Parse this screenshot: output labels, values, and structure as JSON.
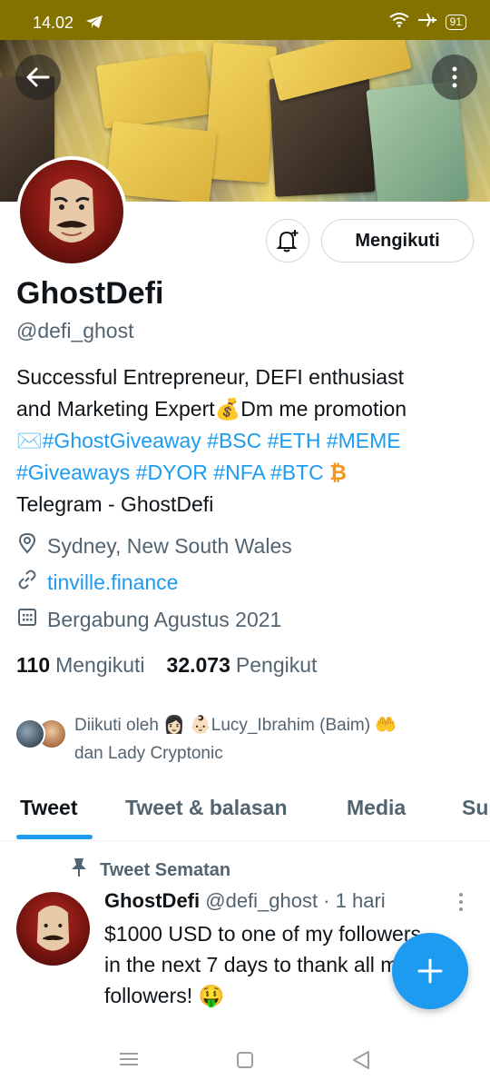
{
  "status_bar": {
    "time": "14.02",
    "battery": "91"
  },
  "profile": {
    "display_name": "GhostDefi",
    "handle": "@defi_ghost",
    "follow_button": "Mengikuti",
    "bio_line1": "Successful Entrepreneur, DEFI enthusiast",
    "bio_line2_a": "and Marketing Expert",
    "bio_line2_emoji": "💰",
    "bio_line2_b": "Dm me promotion",
    "bio_line3_emoji": "✉️",
    "hashtags_line3": "#GhostGiveaway #BSC #ETH #MEME",
    "hashtags_line4": "#Giveaways #DYOR #NFA #BTC",
    "bio_line4_emoji": "₿",
    "bio_line5": "Telegram - GhostDefi",
    "location": "Sydney, New South Wales",
    "website": "tinville.finance",
    "joined": "Bergabung Agustus 2021",
    "following_count": "110",
    "following_label": "Mengikuti",
    "followers_count": "32.073",
    "followers_label": "Pengikut",
    "followed_by_line1": "Diikuti oleh 👩🏻 👶🏻Lucy_Ibrahim (Baim) 🤲",
    "followed_by_line2": "dan Lady Cryptonic"
  },
  "tabs": [
    "Tweet",
    "Tweet & balasan",
    "Media",
    "Su"
  ],
  "pinned_tweet": {
    "label": "Tweet Sematan",
    "name": "GhostDefi",
    "meta": "@defi_ghost · 1 hari",
    "line1": "$1000 USD to one of my followers",
    "line2": "in the next 7 days to thank all my",
    "line3": "followers! 🤑"
  },
  "colors": {
    "accent": "#1d9bf0",
    "status_bar": "#847200",
    "secondary_text": "#536471"
  }
}
